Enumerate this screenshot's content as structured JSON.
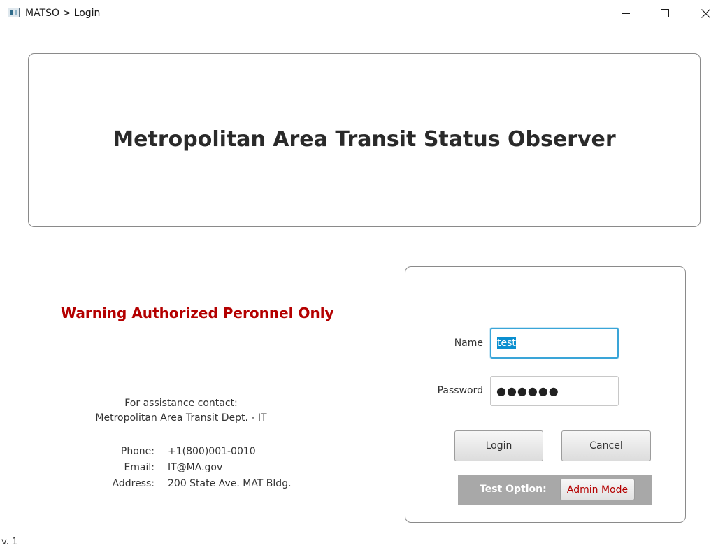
{
  "window": {
    "title": "MATSO > Login",
    "controls": [
      "minimize-icon",
      "maximize-icon",
      "close-icon"
    ]
  },
  "banner": {
    "title": "Metropolitan Area Transit Status Observer"
  },
  "warning": {
    "text": "Warning Authorized Peronnel Only",
    "color": "#b40000"
  },
  "assistance": {
    "line1": "For assistance contact:",
    "line2": "Metropolitan Area Transit Dept. - IT",
    "phone_label": "Phone:",
    "phone_value": "+1(800)001-0010",
    "email_label": "Email:",
    "email_value": "IT@MA.gov",
    "address_label": "Address:",
    "address_value": "200 State Ave. MAT Bldg."
  },
  "login": {
    "name_label": "Name",
    "name_value": "test",
    "password_label": "Password",
    "password_masked": "●●●●●●",
    "login_button": "Login",
    "cancel_button": "Cancel"
  },
  "test_option": {
    "label": "Test Option:",
    "admin_button": "Admin Mode"
  },
  "version": "v. 1",
  "colors": {
    "accent_focus": "#3aa5d8",
    "selection": "#0a8fd0",
    "warning": "#b40000"
  }
}
